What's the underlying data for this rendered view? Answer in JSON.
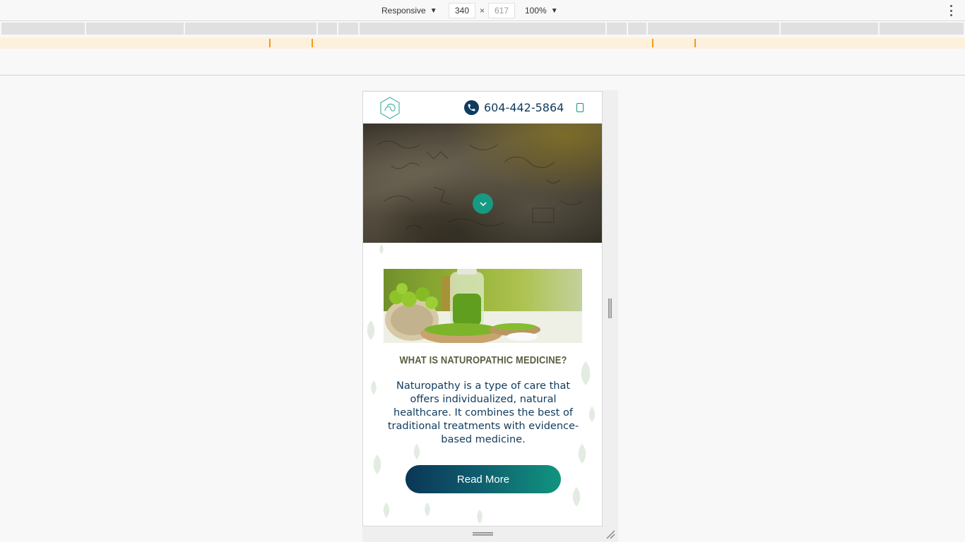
{
  "devtools": {
    "device_mode": "Responsive",
    "width": "340",
    "height": "617",
    "times": "×",
    "zoom": "100%"
  },
  "site": {
    "phone": "604-442-5864",
    "section_title": "WHAT IS NATUROPATHIC MEDICINE?",
    "section_body": "Naturopathy is a type of care that offers individualized, natural healthcare. It combines the best of traditional treatments with evidence-based medicine.",
    "button_label": "Read More"
  },
  "colors": {
    "navy": "#0f3b5e",
    "teal": "#179a82",
    "olive_title": "#5a5e3e"
  },
  "icons": [
    "hexagon-logo-icon",
    "phone-icon",
    "menu-icon",
    "chevron-down-icon",
    "more-vert-icon"
  ]
}
